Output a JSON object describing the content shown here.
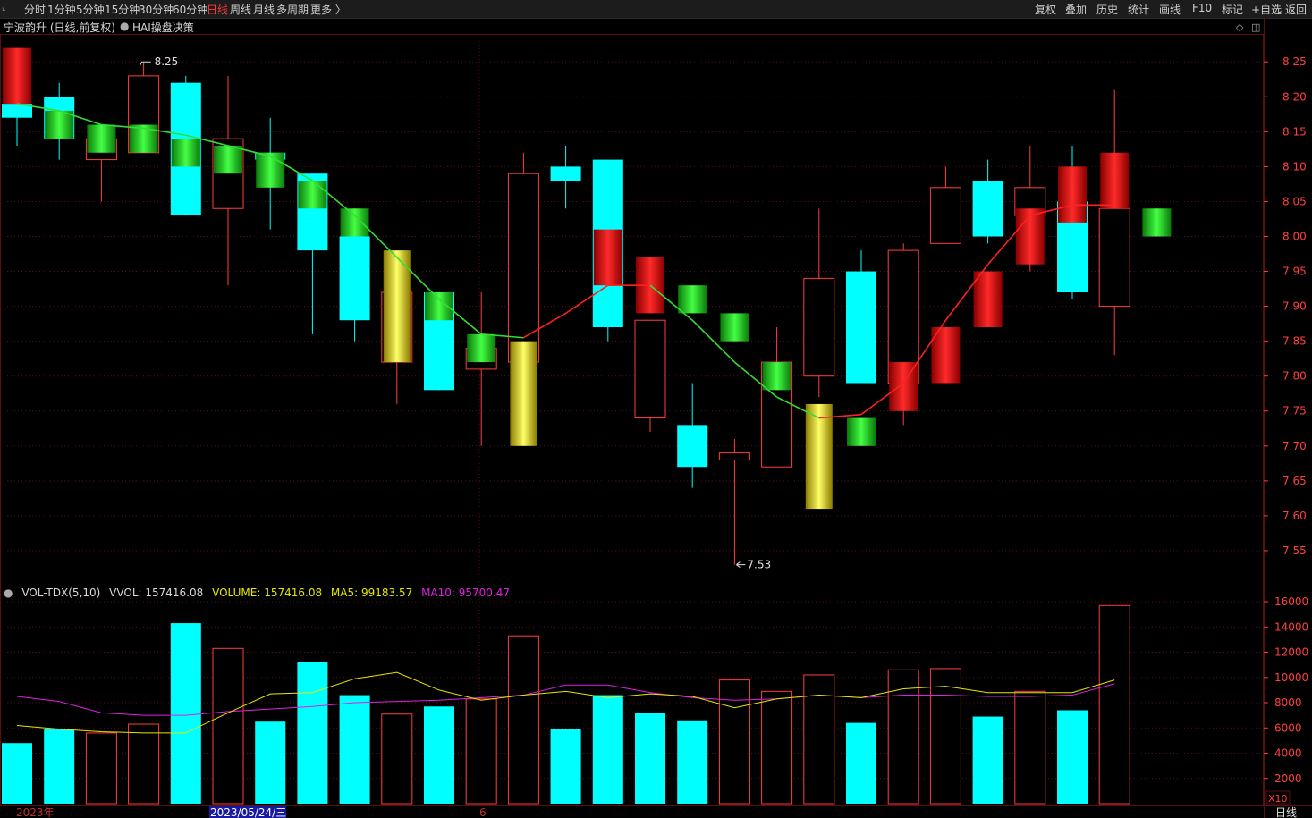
{
  "toolbar": {
    "left": [
      "分时",
      "1分钟",
      "5分钟",
      "15分钟",
      "30分钟",
      "60分钟",
      "日线",
      "周线",
      "月线",
      "多周期",
      "更多 〉"
    ],
    "active": "日线",
    "right": [
      "复权",
      "叠加",
      "历史",
      "统计",
      "画线",
      "F10",
      "标记",
      "+自选",
      "返回"
    ]
  },
  "header": {
    "stock": "宁波韵升 (日线,前复权)",
    "indicator": "HAI操盘决策"
  },
  "volume_header": {
    "name": "VOL-TDX(5,10)",
    "vvol": "VVOL: 157416.08",
    "volume": "VOLUME: 157416.08",
    "ma5": "MA5: 99183.57",
    "ma10": "MA10: 95700.47"
  },
  "annotations": {
    "high": "8.25",
    "low": "7.53"
  },
  "bottom": {
    "year": "2023年",
    "cursor_date": "2023/05/24/三",
    "month": "6",
    "x10": "X10",
    "period": "日线"
  },
  "colors": {
    "up": "#ff3c3c",
    "down": "#00ffff",
    "ma_up": "#ff2020",
    "ma_down": "#33dd33",
    "ma5": "#e6e600",
    "ma10": "#e020e0",
    "grid": "#5a1010",
    "axis_text": "#ff4040"
  },
  "chart_data": [
    {
      "type": "candlestick",
      "y_ticks": [
        "8.25",
        "8.20",
        "8.15",
        "8.10",
        "8.05",
        "8.00",
        "7.95",
        "7.90",
        "7.85",
        "7.80",
        "7.75",
        "7.70",
        "7.65",
        "7.60",
        "7.55"
      ],
      "ylim": [
        7.5,
        8.29
      ],
      "candles": [
        {
          "o": 8.19,
          "c": 8.17,
          "h": 8.19,
          "l": 8.13
        },
        {
          "o": 8.2,
          "c": 8.14,
          "h": 8.22,
          "l": 8.11
        },
        {
          "o": 8.11,
          "c": 8.14,
          "h": 8.16,
          "l": 8.05
        },
        {
          "o": 8.12,
          "c": 8.23,
          "h": 8.25,
          "l": 8.12
        },
        {
          "o": 8.22,
          "c": 8.03,
          "h": 8.23,
          "l": 8.03
        },
        {
          "o": 8.04,
          "c": 8.14,
          "h": 8.23,
          "l": 7.93
        },
        {
          "o": 8.12,
          "c": 8.11,
          "h": 8.17,
          "l": 8.01
        },
        {
          "o": 8.09,
          "c": 7.98,
          "h": 8.09,
          "l": 7.86
        },
        {
          "o": 8.0,
          "c": 7.88,
          "h": 8.0,
          "l": 7.85
        },
        {
          "o": 7.82,
          "c": 7.92,
          "h": 7.94,
          "l": 7.76
        },
        {
          "o": 7.92,
          "c": 7.78,
          "h": 7.92,
          "l": 7.78
        },
        {
          "o": 7.81,
          "c": 7.84,
          "h": 7.92,
          "l": 7.7
        },
        {
          "o": 7.82,
          "c": 8.09,
          "h": 8.12,
          "l": 7.8
        },
        {
          "o": 8.1,
          "c": 8.08,
          "h": 8.13,
          "l": 8.04
        },
        {
          "o": 8.11,
          "c": 7.87,
          "h": 8.11,
          "l": 7.85
        },
        {
          "o": 7.74,
          "c": 7.88,
          "h": 7.88,
          "l": 7.72
        },
        {
          "o": 7.73,
          "c": 7.67,
          "h": 7.79,
          "l": 7.64
        },
        {
          "o": 7.68,
          "c": 7.69,
          "h": 7.71,
          "l": 7.53
        },
        {
          "o": 7.67,
          "c": 7.82,
          "h": 7.87,
          "l": 7.67
        },
        {
          "o": 7.8,
          "c": 7.94,
          "h": 8.04,
          "l": 7.77
        },
        {
          "o": 7.95,
          "c": 7.79,
          "h": 7.98,
          "l": 7.79
        },
        {
          "o": 7.79,
          "c": 7.98,
          "h": 7.99,
          "l": 7.73
        },
        {
          "o": 7.99,
          "c": 8.07,
          "h": 8.1,
          "l": 7.99
        },
        {
          "o": 8.08,
          "c": 8.0,
          "h": 8.11,
          "l": 7.99
        },
        {
          "o": 8.03,
          "c": 8.07,
          "h": 8.13,
          "l": 7.95
        },
        {
          "o": 8.05,
          "c": 7.92,
          "h": 8.13,
          "l": 7.91
        },
        {
          "o": 7.9,
          "c": 8.04,
          "h": 8.21,
          "l": 7.83
        }
      ],
      "signal_bars": [
        {
          "i": 0,
          "top": 8.27,
          "bot": 8.19,
          "color": "red"
        },
        {
          "i": 1,
          "top": 8.18,
          "bot": 8.14,
          "color": "green"
        },
        {
          "i": 2,
          "top": 8.16,
          "bot": 8.12,
          "color": "green"
        },
        {
          "i": 3,
          "top": 8.16,
          "bot": 8.12,
          "color": "green"
        },
        {
          "i": 4,
          "top": 8.14,
          "bot": 8.1,
          "color": "green"
        },
        {
          "i": 5,
          "top": 8.13,
          "bot": 8.09,
          "color": "green"
        },
        {
          "i": 6,
          "top": 8.12,
          "bot": 8.07,
          "color": "green"
        },
        {
          "i": 7,
          "top": 8.08,
          "bot": 8.04,
          "color": "green"
        },
        {
          "i": 8,
          "top": 8.04,
          "bot": 8.0,
          "color": "green"
        },
        {
          "i": 9,
          "top": 7.98,
          "bot": 7.82,
          "color": "yellow"
        },
        {
          "i": 10,
          "top": 7.92,
          "bot": 7.88,
          "color": "green"
        },
        {
          "i": 11,
          "top": 7.86,
          "bot": 7.82,
          "color": "green"
        },
        {
          "i": 12,
          "top": 7.85,
          "bot": 7.7,
          "color": "yellow"
        },
        {
          "i": 14,
          "top": 8.01,
          "bot": 7.93,
          "color": "red"
        },
        {
          "i": 15,
          "top": 7.97,
          "bot": 7.89,
          "color": "red"
        },
        {
          "i": 16,
          "top": 7.93,
          "bot": 7.89,
          "color": "green"
        },
        {
          "i": 17,
          "top": 7.89,
          "bot": 7.85,
          "color": "green"
        },
        {
          "i": 18,
          "top": 7.82,
          "bot": 7.78,
          "color": "green"
        },
        {
          "i": 19,
          "top": 7.76,
          "bot": 7.61,
          "color": "yellow"
        },
        {
          "i": 20,
          "top": 7.74,
          "bot": 7.7,
          "color": "green"
        },
        {
          "i": 21,
          "top": 7.82,
          "bot": 7.75,
          "color": "red"
        },
        {
          "i": 22,
          "top": 7.87,
          "bot": 7.79,
          "color": "red"
        },
        {
          "i": 23,
          "top": 7.95,
          "bot": 7.87,
          "color": "red"
        },
        {
          "i": 24,
          "top": 8.04,
          "bot": 7.96,
          "color": "red"
        },
        {
          "i": 25,
          "top": 8.1,
          "bot": 8.02,
          "color": "red"
        },
        {
          "i": 26,
          "top": 8.12,
          "bot": 8.04,
          "color": "red"
        },
        {
          "i": 27,
          "top": 8.04,
          "bot": 8.0,
          "color": "green"
        }
      ],
      "ma_line": [
        8.19,
        8.18,
        8.16,
        8.155,
        8.145,
        8.13,
        8.115,
        8.08,
        8.03,
        7.97,
        7.91,
        7.86,
        7.855,
        7.89,
        7.93,
        7.93,
        7.88,
        7.82,
        7.77,
        7.74,
        7.745,
        7.79,
        7.88,
        7.96,
        8.03,
        8.045,
        8.045
      ]
    },
    {
      "type": "bar",
      "y_ticks": [
        "16000",
        "14000",
        "12000",
        "10000",
        "8000",
        "6000",
        "4000",
        "2000"
      ],
      "ylim": [
        0,
        16500
      ],
      "volumes": [
        4800,
        5900,
        5600,
        6300,
        14300,
        12300,
        6500,
        11200,
        8600,
        7100,
        7700,
        8300,
        13300,
        5900,
        8600,
        7200,
        6600,
        9800,
        8900,
        10200,
        6400,
        10600,
        10700,
        6900,
        8900,
        7400,
        15700
      ],
      "up": [
        false,
        false,
        true,
        true,
        false,
        true,
        false,
        false,
        false,
        true,
        false,
        true,
        true,
        false,
        false,
        false,
        false,
        true,
        true,
        true,
        false,
        true,
        true,
        false,
        true,
        false,
        true
      ],
      "ma5": [
        6200,
        5900,
        5700,
        5600,
        5600,
        7200,
        8700,
        8800,
        9900,
        10400,
        9000,
        8200,
        8600,
        8900,
        8400,
        8700,
        8500,
        7600,
        8300,
        8600,
        8400,
        9100,
        9300,
        8800,
        8800,
        8800,
        9800
      ],
      "ma10": [
        8500,
        8100,
        7200,
        7000,
        7000,
        7300,
        7500,
        7700,
        8000,
        8100,
        8200,
        8400,
        8600,
        9400,
        9400,
        8800,
        8400,
        8200,
        8300,
        8600,
        8400,
        8600,
        8600,
        8500,
        8500,
        8600,
        9500
      ]
    }
  ]
}
